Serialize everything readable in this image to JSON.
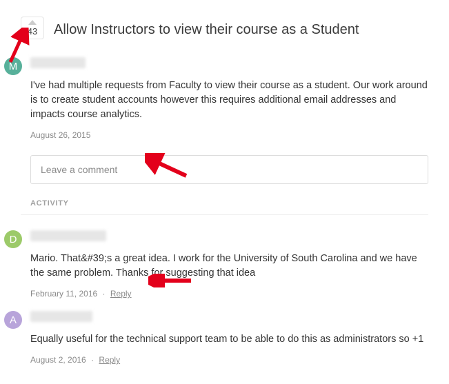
{
  "vote": {
    "count": "43"
  },
  "post": {
    "title": "Allow Instructors to view their course as a Student",
    "avatar_letter": "M",
    "body": "I've had multiple requests from Faculty to view their course as a student. Our work around is to create student accounts however this requires additional email addresses and impacts course analytics.",
    "date": "August 26, 2015"
  },
  "comment_input": {
    "placeholder": "Leave a comment"
  },
  "activity_label": "ACTIVITY",
  "comments": [
    {
      "avatar_letter": "D",
      "body": "Mario. That&#39;s a great idea. I work for the University of South Carolina and we have the same problem. Thanks for suggesting that idea",
      "date": "February 11, 2016",
      "reply": "Reply"
    },
    {
      "avatar_letter": "A",
      "body": "Equally useful for the technical support team to be able to do this as administrators so +1",
      "date": "August 2, 2016",
      "reply": "Reply"
    }
  ],
  "annotations": {
    "arrow_color": "#e3001b"
  }
}
